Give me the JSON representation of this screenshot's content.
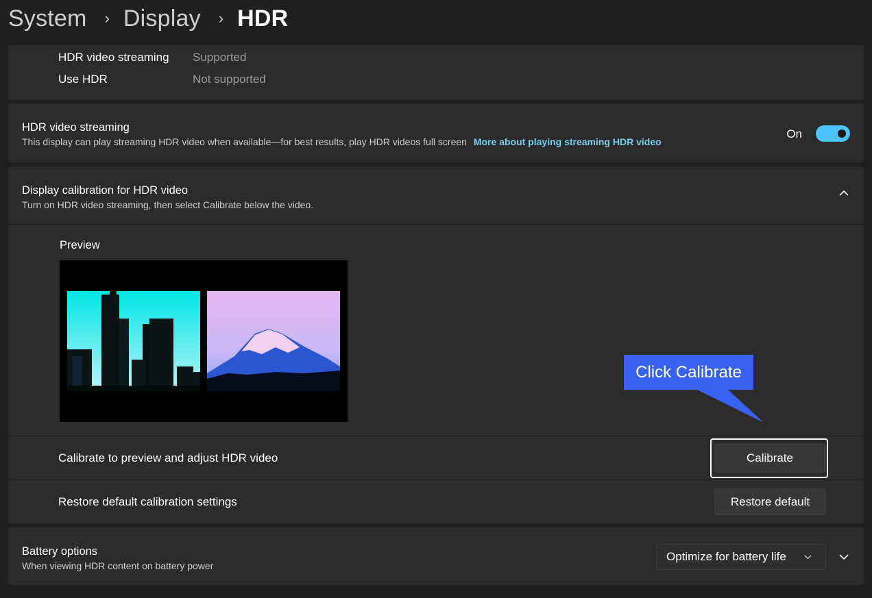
{
  "breadcrumb": {
    "item1": "System",
    "item2": "Display",
    "item3": "HDR",
    "separator": "›"
  },
  "display_capabilities": {
    "rows": [
      {
        "label": "HDR video streaming",
        "value": "Supported"
      },
      {
        "label": "Use HDR",
        "value": "Not supported"
      }
    ]
  },
  "streaming": {
    "title": "HDR video streaming",
    "description": "This display can play streaming HDR video when available—for best results, play HDR videos full screen",
    "link": "More about playing streaming HDR video",
    "toggle_state": "On",
    "toggle_on": true
  },
  "calibration": {
    "title": "Display calibration for HDR video",
    "description": "Turn on HDR video streaming, then select Calibrate below the video.",
    "preview_label": "Preview",
    "calibrate_row_label": "Calibrate to preview and adjust HDR video",
    "calibrate_button": "Calibrate",
    "restore_row_label": "Restore default calibration settings",
    "restore_button": "Restore default"
  },
  "callout": {
    "text": "Click Calibrate"
  },
  "battery": {
    "title": "Battery options",
    "description": "When viewing HDR content on battery power",
    "selected_option": "Optimize for battery life"
  },
  "colors": {
    "accent": "#4cc2ff",
    "link": "#77d0f0",
    "callout": "#3a62f0",
    "card": "#2b2b2b",
    "background": "#202020"
  },
  "icons": {
    "expand_up": "chevron-up-icon",
    "expand_down": "chevron-down-icon",
    "dropdown": "chevron-down-icon"
  }
}
